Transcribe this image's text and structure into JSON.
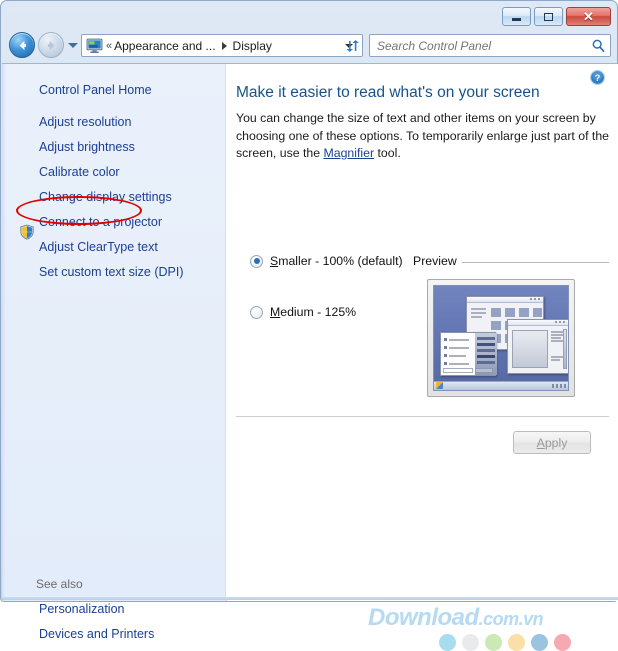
{
  "window": {
    "caption_buttons": [
      {
        "name": "minimize",
        "label": ""
      },
      {
        "name": "maximize",
        "label": ""
      },
      {
        "name": "close",
        "label": "✕"
      }
    ]
  },
  "navigation": {
    "back_icon": "back-arrow-icon",
    "forward_icon": "forward-arrow-icon",
    "recent_pages_icon": "chevron-down-icon",
    "refresh_icon": "refresh-icon",
    "address": {
      "location_icon": "display-monitor-icon",
      "overflow": "«",
      "crumbs": [
        "Appearance and ...",
        "Display"
      ],
      "dropdown_icon": "chevron-down-icon"
    },
    "search": {
      "placeholder": "Search Control Panel",
      "value": "",
      "icon": "search-icon"
    }
  },
  "sidebar": {
    "home_link": "Control Panel Home",
    "items": [
      {
        "label": "Adjust resolution",
        "shield": false
      },
      {
        "label": "Adjust brightness",
        "shield": false,
        "highlighted": true
      },
      {
        "label": "Calibrate color",
        "shield": true
      },
      {
        "label": "Change display settings",
        "shield": false
      },
      {
        "label": "Connect to a projector",
        "shield": false
      },
      {
        "label": "Adjust ClearType text",
        "shield": false
      },
      {
        "label": "Set custom text size (DPI)",
        "shield": false
      }
    ],
    "see_also_label": "See also",
    "see_also_items": [
      {
        "label": "Personalization"
      },
      {
        "label": "Devices and Printers"
      }
    ]
  },
  "content": {
    "help_icon": "help-question-icon",
    "title": "Make it easier to read what's on your screen",
    "description_part1": "You can change the size of text and other items on your screen by choosing one of these options. To temporarily enlarge just part of the screen, use the ",
    "description_link": "Magnifier",
    "description_part2": " tool.",
    "options": [
      {
        "prefix": "",
        "accel": "S",
        "rest": "maller - 100% (default)",
        "checked": true
      },
      {
        "prefix": "",
        "accel": "M",
        "rest": "edium - 125%",
        "checked": false
      }
    ],
    "preview_label": "Preview",
    "preview_icon": "desktop-preview-image",
    "apply_button": {
      "label": "Apply",
      "accel": "A",
      "enabled": false
    }
  },
  "watermark": {
    "main": "Download",
    "suffix": ".com.vn",
    "dot_colors": [
      "#a8ddf0",
      "#e9eaec",
      "#cce8b5",
      "#fadfa8",
      "#9cc3e0",
      "#f6a8b3"
    ]
  },
  "colors": {
    "link": "#1c3f94",
    "title": "#16538c",
    "accent_red": "#e00000",
    "sidebar_bg": "#e7effb"
  }
}
